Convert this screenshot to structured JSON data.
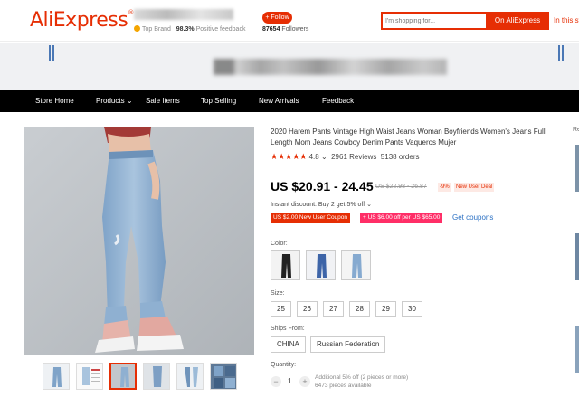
{
  "header": {
    "logo_text": "AliExpress",
    "logo_mark": "®",
    "brand_color": "#e62e04",
    "store": {
      "badge_label": "Top Brand",
      "positive_percent": "98.3%",
      "positive_label": "Positive feedback",
      "follow_label": "+ Follow",
      "followers_count": "87654",
      "followers_label": "Followers"
    },
    "search": {
      "placeholder": "I'm shopping for...",
      "btn_aliexpress": "On AliExpress",
      "btn_store": "In this store"
    }
  },
  "nav": {
    "items": [
      "Store Home",
      "Products",
      "Sale Items",
      "Top Selling",
      "New Arrivals",
      "Feedback"
    ],
    "products_arrow": "⌄"
  },
  "product": {
    "title": "2020 Harem Pants Vintage High Waist Jeans Woman Boyfriends Women's Jeans Full Length Mom Jeans Cowboy Denim Pants Vaqueros Mujer",
    "stars": "★★★★★",
    "rating": "4.8",
    "rating_arrow": "⌄",
    "reviews": "2961 Reviews",
    "orders": "5138 orders",
    "price": "US $20.91 - 24.45",
    "old_price": "US $22.98 - 26.87",
    "discount": "-9%",
    "new_user_deal": "New User Deal",
    "instant_discount": "Instant discount: Buy 2 get 5% off",
    "instant_arrow": "⌄",
    "coupon1": "US $2.00 New User Coupon",
    "coupon2": "+ US $6.00 off per US $65.00",
    "get_coupons": "Get coupons",
    "color_label": "Color:",
    "size_label": "Size:",
    "sizes": [
      "25",
      "26",
      "27",
      "28",
      "29",
      "30"
    ],
    "ships_from_label": "Ships From:",
    "ships_from": [
      "CHINA",
      "Russian Federation"
    ],
    "quantity_label": "Quantity:",
    "quantity": "1",
    "qty_minus": "−",
    "qty_plus": "+",
    "additional_discount": "Additional 5% off (2 pieces or more)",
    "pieces_available": "6473 pieces available"
  },
  "right_column": {
    "label": "Re"
  }
}
